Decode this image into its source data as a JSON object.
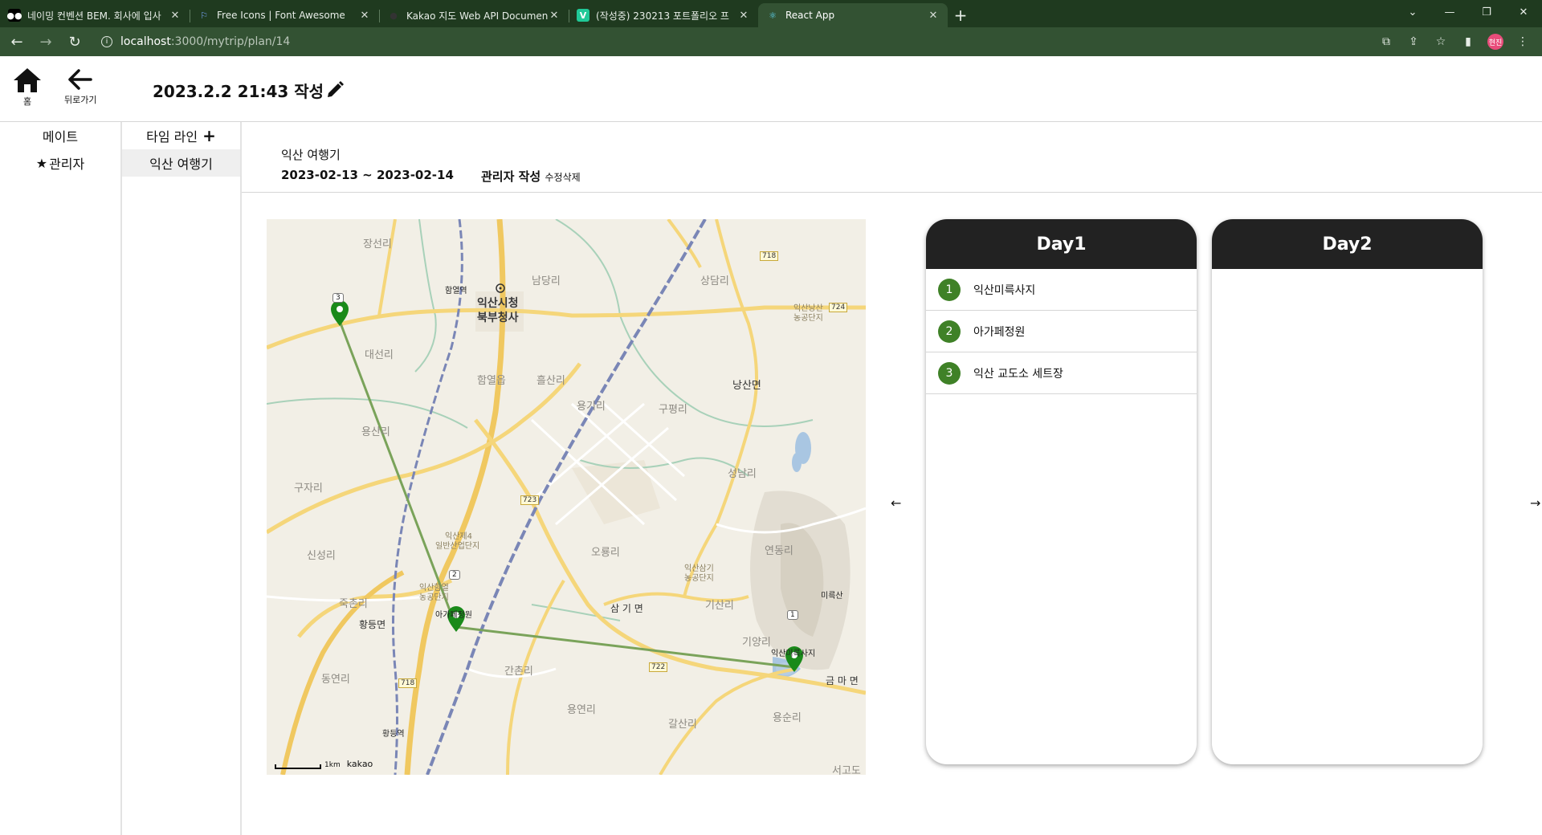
{
  "browser": {
    "tabs": [
      {
        "title": "네이밍 컨벤션 BEM. 회사에 입사",
        "icon": "medium-icon",
        "active": false
      },
      {
        "title": "Free Icons | Font Awesome",
        "icon": "flag-icon",
        "active": false
      },
      {
        "title": "Kakao 지도 Web API Document",
        "icon": "github-icon",
        "active": false
      },
      {
        "title": "(작성중) 230213 포트폴리오 프",
        "icon": "velog-icon",
        "active": false
      },
      {
        "title": "React App",
        "icon": "react-icon",
        "active": true
      }
    ],
    "url_host": "localhost",
    "url_path": ":3000/mytrip/plan/14",
    "profile_label": "현진"
  },
  "header": {
    "home_label": "홈",
    "back_label": "뒤로가기",
    "title": "2023.2.2 21:43 작성"
  },
  "sidebar_mate": {
    "heading": "메이트",
    "items": [
      {
        "label": "관리자"
      }
    ]
  },
  "sidebar_timeline": {
    "heading": "타임 라인",
    "add_icon": "+",
    "items": [
      {
        "label": "익산 여행기",
        "active": true
      }
    ]
  },
  "trip": {
    "name": "익산 여행기",
    "dates": "2023-02-13 ~ 2023-02-14",
    "author": "관리자 작성",
    "edit_label": "수정",
    "delete_label": "삭제"
  },
  "map": {
    "labels": {
      "city_hall": "익산시청",
      "north_office": "북부청사",
      "hamyeol_station": "함열역",
      "hamyeol_eup": "함열읍",
      "nangsan_myeon": "낭산면",
      "samgi_myeon": "삼 기 면",
      "geumma_myeon": "금 마 면",
      "hwangdeung_myeon": "황등면",
      "hwangdeung_station": "황등역",
      "mireuksan": "미륵산",
      "jangseon_ri": "장선리",
      "namdang_ri": "남당리",
      "sangdam_ri": "상담리",
      "daeseon_ri": "대선리",
      "heulsan_ri": "흘산리",
      "yonggi_ri": "용기리",
      "gupyeong_ri": "구평리",
      "seongnam_ri": "성남리",
      "yeondong_ri": "연동리",
      "ohryong_ri": "오룡리",
      "gisan_ri": "기산리",
      "giyang_ri": "기양리",
      "gujari": "구자리",
      "yongsan_ri": "용산리",
      "sinseong_ri": "신성리",
      "jukchon_ri": "죽촌리",
      "dongyeon_ri": "동연리",
      "ganchon_ri": "간촌리",
      "yongyeon_ri": "용연리",
      "gagsan_ri": "갈산리",
      "yongsun_ri": "용순리",
      "seogo_do": "서고도",
      "industrial_1": "익산제4",
      "industrial_1b": "일반산업단지",
      "industrial_2": "익산삼기",
      "industrial_2b": "농공단지",
      "industrial_3": "익산낭산",
      "industrial_3b": "농공단지",
      "industrial_4": "익산함열",
      "industrial_4b": "농공단지",
      "place_agape": "아가페정원",
      "place_mireuk": "익산미륵사지",
      "road_718_a": "718",
      "road_718_b": "718",
      "road_724": "724",
      "road_723": "723",
      "road_722": "722",
      "marker_1": "1",
      "marker_2": "2",
      "marker_3": "3",
      "scale": "1km",
      "brand": "kakao"
    }
  },
  "days": [
    {
      "title": "Day1",
      "places": [
        {
          "num": "1",
          "name": "익산미륵사지"
        },
        {
          "num": "2",
          "name": "아가페정원"
        },
        {
          "num": "3",
          "name": "익산 교도소 세트장"
        }
      ]
    },
    {
      "title": "Day2",
      "places": []
    }
  ],
  "nav": {
    "prev": "←",
    "next": "→"
  },
  "colors": {
    "marker": "#1a8a1a",
    "route": "#7aa35a",
    "day_header": "#222222",
    "place_badge": "#3f8127"
  }
}
